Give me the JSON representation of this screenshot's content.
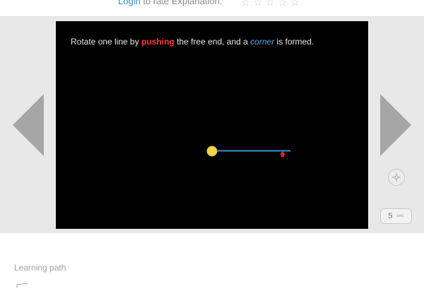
{
  "rating": {
    "login_label": "Login",
    "prompt_text": " to rate Explanation.",
    "stars": [
      "☆",
      "☆",
      "☆",
      "☆",
      "☆"
    ]
  },
  "stage": {
    "caption": {
      "part1": "Rotate one line by ",
      "push_word": "pushing",
      "part2": " the free end, and a ",
      "corner_word": "corner",
      "part3": " is formed."
    },
    "colors": {
      "line": "#3c8fd6",
      "pivot": "#f3d54a",
      "push_arrow": "#e02828",
      "background": "#000000"
    }
  },
  "navigation": {
    "prev_icon": "triangle-left-icon",
    "next_icon": "triangle-right-icon"
  },
  "controls": {
    "round_button_icon": "crosshair-icon",
    "counter_value": "5",
    "counter_unit": "sec"
  },
  "footer": {
    "learning_path_label": "Learning path"
  }
}
